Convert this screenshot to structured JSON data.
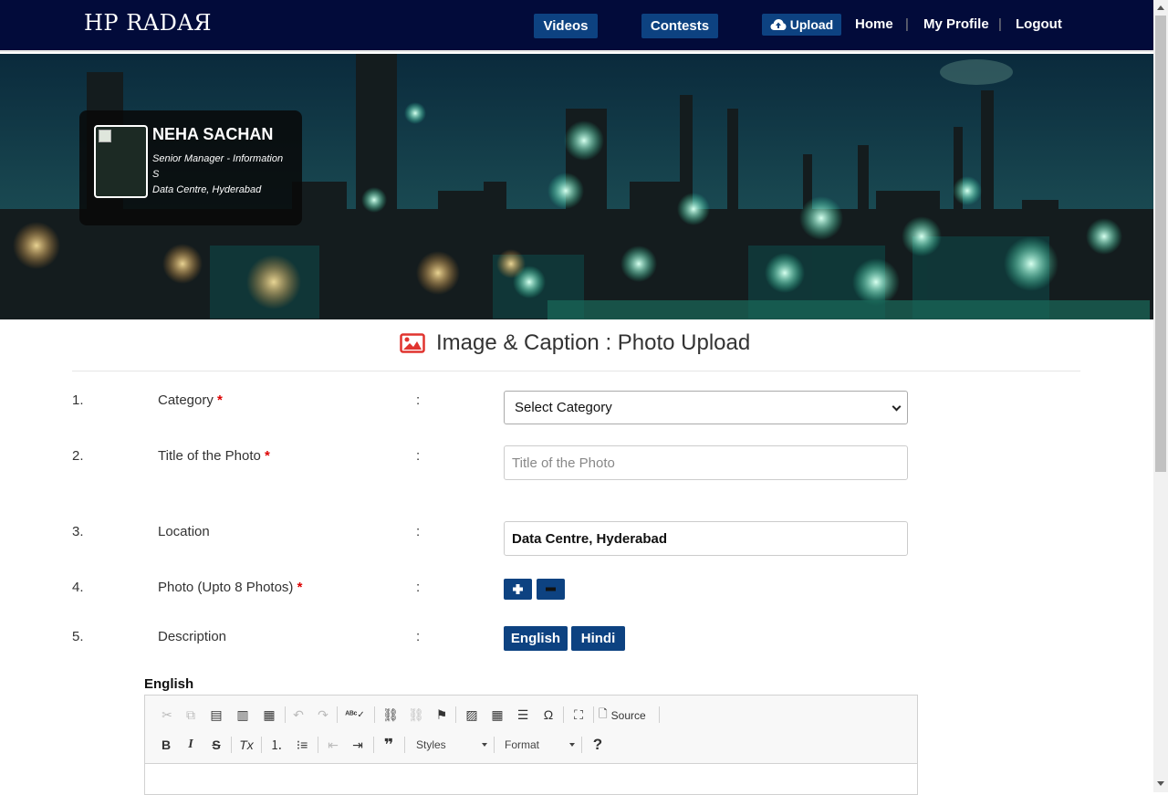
{
  "nav": {
    "brand": "HP RADAЯ",
    "videos": "Videos",
    "contests": "Contests",
    "upload": "Upload",
    "home": "Home",
    "my_profile": "My Profile",
    "logout": "Logout",
    "separator": "|"
  },
  "profile": {
    "name": "NEHA SACHAN",
    "designation_line1": "Senior Manager - Information",
    "designation_line2": "S",
    "location": "Data Centre, Hyderabad"
  },
  "page": {
    "heading": "Image & Caption : Photo Upload"
  },
  "form": {
    "rows": [
      {
        "num": "1.",
        "label": "Category",
        "required": "*",
        "colon": ":"
      },
      {
        "num": "2.",
        "label": "Title of the Photo",
        "required": "*",
        "colon": ":"
      },
      {
        "num": "3.",
        "label": "Location",
        "required": "",
        "colon": ":"
      },
      {
        "num": "4.",
        "label": "Photo (Upto 8 Photos)",
        "required": "*",
        "colon": ":"
      },
      {
        "num": "5.",
        "label": "Description",
        "required": "",
        "colon": ":"
      }
    ],
    "category_selected": "Select Category",
    "title_placeholder": "Title of the Photo",
    "location_value": "Data Centre, Hyderabad",
    "desc_english": "English",
    "desc_hindi": "Hindi"
  },
  "editor": {
    "label": "English",
    "source": "Source",
    "styles": "Styles",
    "format": "Format",
    "help": "?",
    "bold": "B",
    "italic": "I",
    "strike": "S",
    "quote": "❞",
    "special_char": "Ω"
  }
}
